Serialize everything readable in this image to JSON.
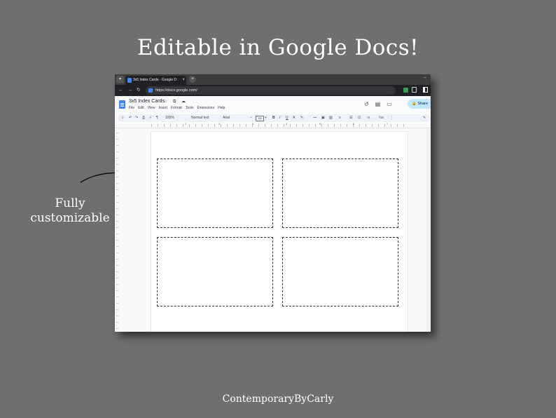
{
  "headline": "Editable in Google Docs!",
  "side_label": {
    "line1": "Fully",
    "line2": "customizable"
  },
  "footer": "ContemporaryByCarly",
  "browser": {
    "tab_title": "3x5 Index Cards - Google Docs",
    "tab_close": "×",
    "new_tab": "+",
    "url": "https://docs.google.com/"
  },
  "docs": {
    "title": "3x5 Index Cards",
    "title_icons": "☆ ⧉ ☁",
    "menus": [
      "File",
      "Edit",
      "View",
      "Insert",
      "Format",
      "Tools",
      "Extensions",
      "Help"
    ],
    "share_label": "Share",
    "toolbar": {
      "zoom": "100%",
      "style": "Normal text",
      "font": "Arial",
      "font_size": "11"
    },
    "ruler_numbers": [
      "1",
      "2",
      "3",
      "4",
      "5",
      "6",
      "7"
    ],
    "cards": [
      {
        "name": "index-card-1"
      },
      {
        "name": "index-card-2"
      },
      {
        "name": "index-card-3"
      },
      {
        "name": "index-card-4"
      }
    ]
  },
  "icons": [
    "arrow-curve",
    "search-icon",
    "undo-icon",
    "redo-icon",
    "print-icon",
    "paint-format-icon",
    "bold-icon",
    "italic-icon",
    "underline-icon",
    "link-icon",
    "share-lock-icon"
  ]
}
